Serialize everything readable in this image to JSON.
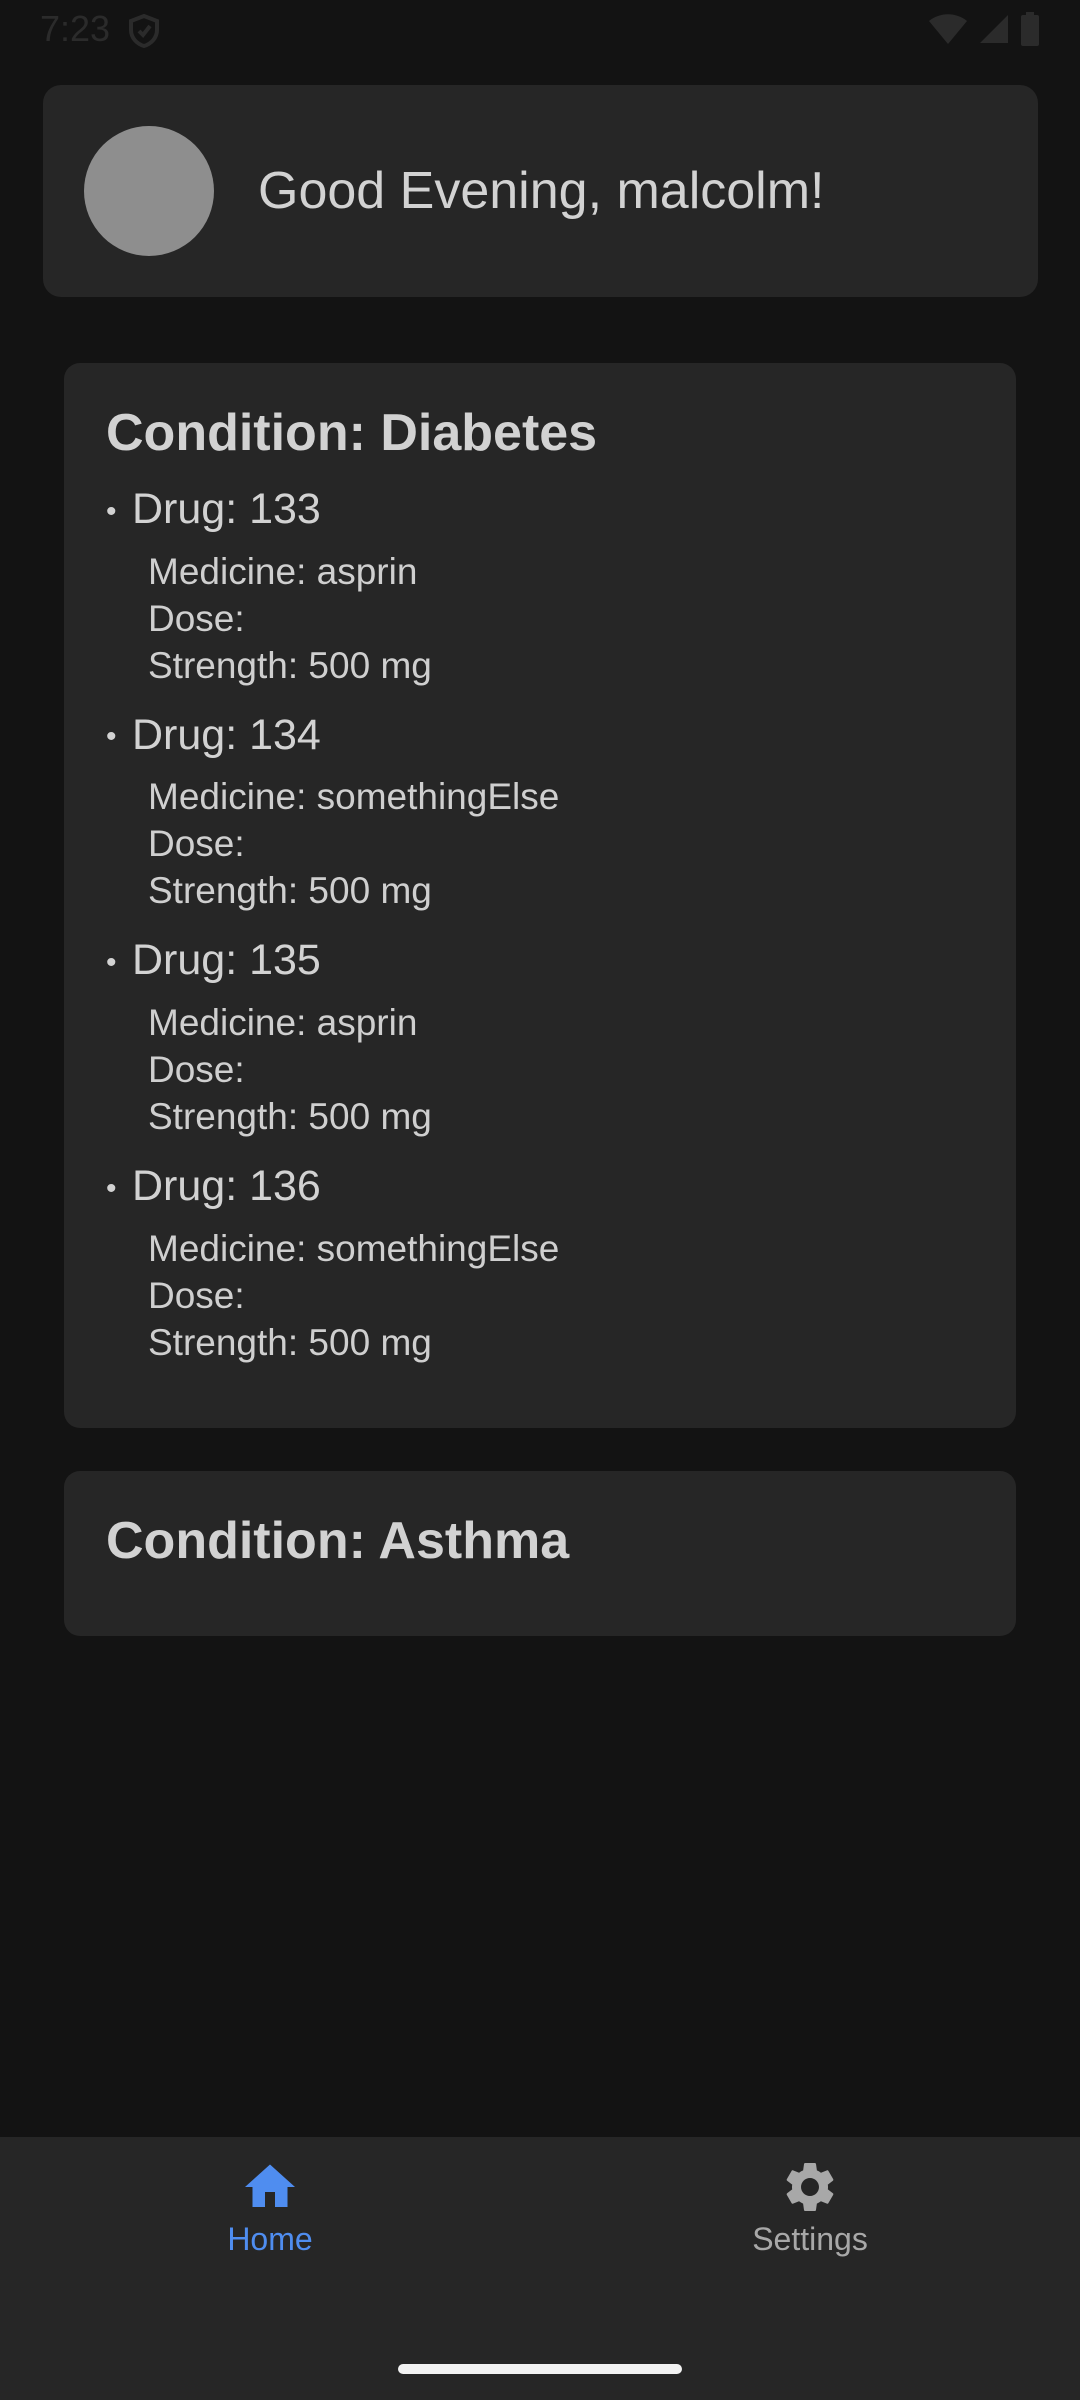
{
  "status_bar": {
    "time": "7:23",
    "icons": [
      "shield-icon",
      "wifi-icon",
      "signal-icon",
      "battery-icon"
    ]
  },
  "greeting": {
    "text": "Good Evening, malcolm!",
    "avatar_color": "#8e8e8e"
  },
  "conditions": [
    {
      "title": "Condition: Diabetes",
      "drugs": [
        {
          "title": "Drug: 133",
          "medicine": "Medicine: asprin",
          "dose": "Dose:",
          "strength": "Strength: 500 mg"
        },
        {
          "title": "Drug: 134",
          "medicine": "Medicine: somethingElse",
          "dose": "Dose:",
          "strength": "Strength: 500 mg"
        },
        {
          "title": "Drug: 135",
          "medicine": "Medicine: asprin",
          "dose": "Dose:",
          "strength": "Strength: 500 mg"
        },
        {
          "title": "Drug: 136",
          "medicine": "Medicine: somethingElse",
          "dose": "Dose:",
          "strength": "Strength: 500 mg"
        }
      ]
    },
    {
      "title": "Condition: Asthma",
      "drugs": []
    }
  ],
  "bottom_nav": {
    "items": [
      {
        "label": "Home",
        "icon": "home-icon",
        "active": true
      },
      {
        "label": "Settings",
        "icon": "gear-icon",
        "active": false
      }
    ]
  },
  "colors": {
    "background": "#131313",
    "card": "#262626",
    "accent": "#4f8df0",
    "text": "#d2d2d2",
    "inactive": "#a8a8a8"
  }
}
